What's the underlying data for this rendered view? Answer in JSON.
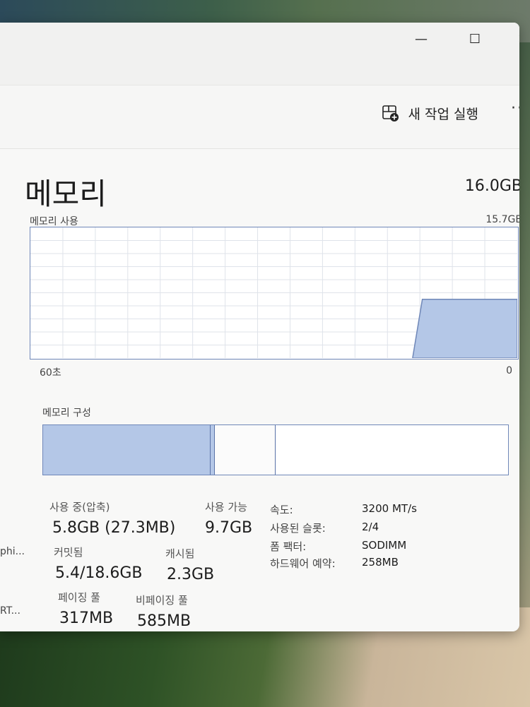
{
  "toolbar": {
    "run_task_label": "새 작업 실행",
    "more_label": "··"
  },
  "memory": {
    "title": "메모리",
    "total": "16.0GB",
    "usage_label": "메모리 사용",
    "usage_max": "15.7GB",
    "graph_left_label": "60초",
    "graph_right_label": "0",
    "graph_level_fraction": 0.45,
    "composition_label": "메모리 구성",
    "composition_in_use_fraction": 0.36,
    "composition_modified_fraction": 0.01,
    "composition_standby_fraction": 0.13
  },
  "stats": {
    "in_use_label": "사용 중(압축)",
    "in_use_value": "5.8GB (27.3MB)",
    "available_label": "사용 가능",
    "available_value": "9.7GB",
    "committed_label": "커밋됨",
    "committed_value": "5.4/18.6GB",
    "cached_label": "캐시됨",
    "cached_value": "2.3GB",
    "paged_pool_label": "페이징 풀",
    "paged_pool_value": "317MB",
    "nonpaged_pool_label": "비페이징 풀",
    "nonpaged_pool_value": "585MB"
  },
  "specs": {
    "speed_label": "속도:",
    "speed_value": "3200 MT/s",
    "slots_label": "사용된 슬롯:",
    "slots_value": "2/4",
    "form_factor_label": "폼 팩터:",
    "form_factor_value": "SODIMM",
    "hw_reserved_label": "하드웨어 예약:",
    "hw_reserved_value": "258MB"
  },
  "sidebar": {
    "item1": "phi...",
    "item2": "RT..."
  },
  "colors": {
    "graph_border": "#6f87b8",
    "graph_fill": "#b4c7e7",
    "segment_border": "#5a73a8"
  }
}
